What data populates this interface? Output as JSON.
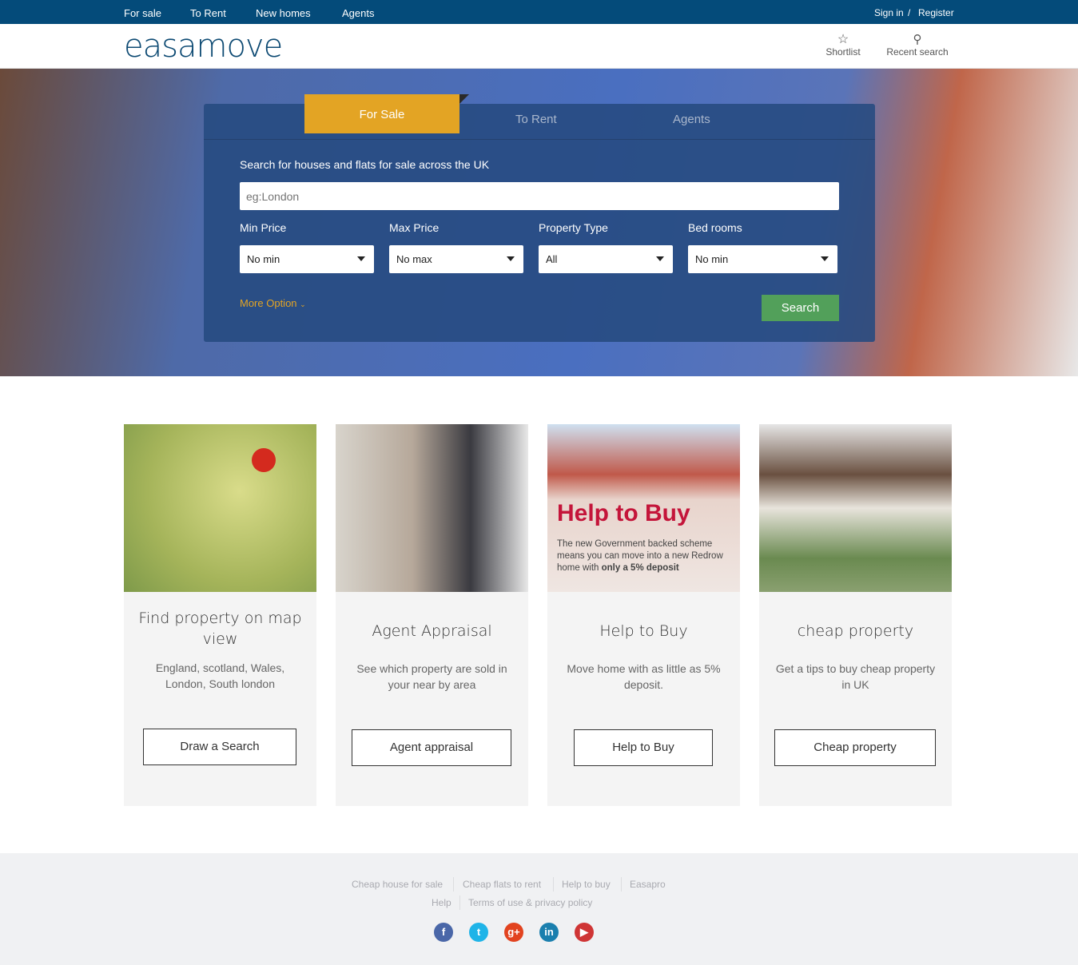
{
  "topnav": {
    "items": [
      "For sale",
      "To Rent",
      "New homes",
      "Agents"
    ],
    "sign_in": "Sign in",
    "slash": "/",
    "register": "Register"
  },
  "header": {
    "logo": "easamove",
    "shortlist": "Shortlist",
    "recent_search": "Recent search"
  },
  "search": {
    "tabs": [
      "For Sale",
      "To Rent",
      "Agents"
    ],
    "heading": "Search for houses and flats for sale across the UK",
    "placeholder": "eg:London",
    "fields": [
      {
        "label": "Min Price",
        "value": "No min"
      },
      {
        "label": "Max Price",
        "value": "No max"
      },
      {
        "label": "Property Type",
        "value": "All"
      },
      {
        "label": "Bed rooms",
        "value": "No min"
      }
    ],
    "more_option": "More Option",
    "search_button": "Search",
    "accent": "#e3a424",
    "button_color": "#52a05a"
  },
  "cards": [
    {
      "title": "Find property on map view",
      "desc": "England, scotland, Wales, London, South london",
      "button": "Draw a Search"
    },
    {
      "title": "Agent Appraisal",
      "desc": "See which property are sold in your near by area",
      "button": "Agent appraisal"
    },
    {
      "title": "Help to Buy",
      "desc": "Move home with as little as 5% deposit.",
      "button": "Help to Buy",
      "image_heading": "Help to Buy",
      "image_text": "The new Government backed scheme means you can move into a new Redrow home with",
      "image_text_bold": "only a 5% deposit"
    },
    {
      "title": "cheap property",
      "desc": "Get a tips to buy cheap property in UK",
      "button": "Cheap property"
    }
  ],
  "footer": {
    "links": [
      "Cheap house for sale",
      "Cheap flats to rent",
      "Help to buy",
      "Easapro",
      "Help",
      "Terms of use & privacy policy"
    ],
    "social": [
      "facebook-icon",
      "twitter-icon",
      "google-plus-icon",
      "linkedin-icon",
      "youtube-icon"
    ]
  }
}
